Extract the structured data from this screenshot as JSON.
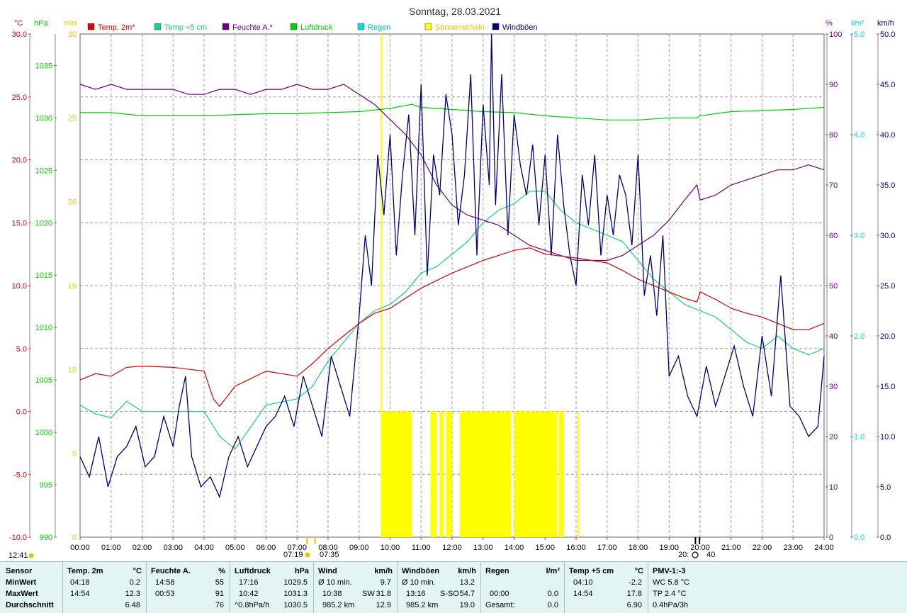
{
  "title": "Sonntag, 28.03.2021",
  "time_marker": "12:41",
  "sun_times": {
    "rise": "07:19",
    "rise_civil": "07:35",
    "set": "20:",
    "set2": "40"
  },
  "colors": {
    "temp": "#e00000",
    "temp5": "#19d27d",
    "humidity": "#6a0080",
    "pressure": "#00d000",
    "rain": "#00e0e0",
    "sunshine": "#ffff00",
    "gusts": "#00007a",
    "bg_footer": "#e2f4f4"
  },
  "axes": {
    "left": [
      {
        "unit": "°C",
        "ticks": [
          "30.0",
          "25.0",
          "20.0",
          "15.0",
          "10.0",
          "5.0",
          "0.0",
          "-5.0",
          "-10.0"
        ],
        "min": -10,
        "max": 30
      },
      {
        "unit": "hPa",
        "ticks": [
          "1035",
          "1030",
          "1025",
          "1020",
          "1015",
          "1010",
          "1005",
          "1000",
          "995",
          "990"
        ],
        "min": 990,
        "max": 1038
      },
      {
        "unit": "min",
        "ticks": [
          "30",
          "25",
          "20",
          "15",
          "10",
          "5",
          "0"
        ],
        "min": 0,
        "max": 30
      }
    ],
    "right": [
      {
        "unit": "%",
        "ticks": [
          "100",
          "90",
          "80",
          "70",
          "60",
          "50",
          "40",
          "30",
          "20",
          "10",
          "0"
        ],
        "min": 0,
        "max": 100
      },
      {
        "unit": "l/m²",
        "ticks": [
          "5.0",
          "4.0",
          "3.0",
          "2.0",
          "1.0",
          "0.0"
        ],
        "min": 0,
        "max": 5
      },
      {
        "unit": "km/h",
        "ticks": [
          "50.0",
          "45.0",
          "40.0",
          "35.0",
          "30.0",
          "25.0",
          "20.0",
          "15.0",
          "10.0",
          "5.0",
          "0.0"
        ],
        "min": 0,
        "max": 50
      }
    ],
    "x_ticks": [
      "00:00",
      "01:00",
      "02:00",
      "03:00",
      "04:00",
      "05:00",
      "06:00",
      "07:00",
      "08:00",
      "09:00",
      "10:00",
      "11:00",
      "12:00",
      "13:00",
      "14:00",
      "15:00",
      "16:00",
      "17:00",
      "18:00",
      "19:00",
      "20:00",
      "21:00",
      "22:00",
      "23:00",
      "24:00"
    ]
  },
  "legend": [
    {
      "label": "Temp. 2m*",
      "color": "#e00000"
    },
    {
      "label": "Temp +5 cm",
      "color": "#19d27d"
    },
    {
      "label": "Feuchte A.*",
      "color": "#6a0080"
    },
    {
      "label": "Luftdruck",
      "color": "#00d000"
    },
    {
      "label": "Regen",
      "color": "#00e0e0"
    },
    {
      "label": "Sonnenschein",
      "color": "#ffff00"
    },
    {
      "label": "Windböen",
      "color": "#00007a"
    }
  ],
  "chart_data": {
    "type": "line",
    "title": "Sonntag, 28.03.2021",
    "x_unit": "hours",
    "xlim": [
      0,
      24
    ],
    "grid": true,
    "legend_placement": "top",
    "series": [
      {
        "name": "Temp. 2m*",
        "axis": "°C",
        "x": [
          0,
          0.5,
          1,
          1.5,
          2,
          3,
          4,
          4.3,
          4.5,
          5,
          6,
          7,
          7.5,
          8,
          8.5,
          9,
          9.5,
          10,
          10.5,
          11,
          11.5,
          12,
          12.5,
          13,
          13.5,
          14,
          14.5,
          15,
          16,
          17,
          17.5,
          18,
          18.5,
          19,
          19.5,
          19.9,
          20,
          20.5,
          21,
          21.5,
          22,
          22.5,
          23,
          23.5,
          24
        ],
        "values": [
          2.5,
          3.0,
          2.8,
          3.5,
          3.6,
          3.5,
          3.2,
          1.0,
          0.4,
          2.0,
          3.2,
          2.8,
          3.8,
          5.0,
          6.0,
          7.0,
          7.8,
          8.2,
          9.0,
          9.8,
          10.4,
          11.0,
          11.5,
          12.0,
          12.4,
          12.8,
          13.0,
          12.5,
          12.2,
          11.8,
          11.2,
          10.5,
          10.0,
          9.5,
          9.0,
          8.7,
          9.5,
          8.9,
          8.2,
          7.8,
          7.5,
          7.0,
          6.5,
          6.5,
          7.0
        ]
      },
      {
        "name": "Temp +5 cm",
        "axis": "°C",
        "x": [
          0,
          0.5,
          1,
          1.5,
          2,
          3,
          4,
          4.5,
          5,
          6,
          7,
          7.5,
          8,
          8.5,
          9,
          9.5,
          10,
          10.5,
          11,
          11.5,
          12,
          12.5,
          13,
          13.5,
          14,
          14.5,
          15,
          15.5,
          16,
          16.5,
          17,
          17.5,
          18,
          18.5,
          19,
          19.5,
          20,
          20.5,
          21,
          21.5,
          22,
          22.5,
          23,
          23.5,
          24
        ],
        "values": [
          0.5,
          -0.2,
          -0.5,
          0.8,
          0.0,
          0.0,
          0.0,
          -2.0,
          -3.0,
          0.5,
          1.0,
          2.0,
          4.0,
          5.5,
          7.0,
          8.0,
          8.5,
          9.5,
          11.0,
          11.5,
          12.5,
          13.5,
          15.0,
          16.0,
          16.5,
          17.5,
          17.5,
          16.0,
          15.0,
          14.5,
          14.0,
          13.5,
          12.0,
          10.5,
          9.5,
          8.5,
          8.0,
          7.5,
          6.5,
          5.5,
          5.0,
          6.0,
          5.0,
          4.5,
          5.0
        ]
      },
      {
        "name": "Feuchte A.*",
        "axis": "%",
        "x": [
          0,
          0.5,
          1,
          1.5,
          2,
          2.5,
          3,
          3.5,
          4,
          4.5,
          5,
          5.5,
          6,
          6.5,
          7,
          7.5,
          8,
          8.5,
          9,
          9.5,
          10,
          10.5,
          11,
          11.5,
          12,
          12.5,
          13,
          13.5,
          14,
          14.5,
          15,
          15.5,
          16,
          16.5,
          17,
          17.5,
          18,
          18.5,
          19,
          19.5,
          19.9,
          20,
          20.5,
          21,
          21.5,
          22,
          22.5,
          23,
          23.5,
          24
        ],
        "values": [
          90,
          89,
          90,
          89,
          89,
          89,
          89,
          88,
          88,
          89,
          89,
          88,
          89,
          89,
          90,
          89,
          89,
          90,
          88,
          86,
          83,
          80,
          76,
          70,
          66,
          64,
          63,
          62,
          60,
          58,
          57,
          56,
          55,
          55,
          55,
          56,
          58,
          60,
          63,
          67,
          70,
          67,
          68,
          70,
          71,
          72,
          73,
          73,
          74,
          73
        ]
      },
      {
        "name": "Luftdruck",
        "axis": "hPa",
        "x": [
          0,
          1,
          2,
          3,
          4,
          5,
          6,
          7,
          8,
          9,
          10,
          10.7,
          11,
          12,
          13,
          14,
          15,
          16,
          17,
          18,
          19,
          19.9,
          20,
          21,
          22,
          23,
          24
        ],
        "values": [
          1030.5,
          1030.5,
          1030.2,
          1030.2,
          1030.2,
          1030.3,
          1030.4,
          1030.4,
          1030.5,
          1030.6,
          1030.9,
          1031.3,
          1031.0,
          1030.8,
          1030.6,
          1030.5,
          1030.2,
          1030.0,
          1029.8,
          1029.8,
          1030.0,
          1030.0,
          1030.2,
          1030.6,
          1030.7,
          1030.8,
          1031.0
        ]
      },
      {
        "name": "Windböen",
        "axis": "km/h",
        "x": [
          0,
          0.3,
          0.6,
          0.9,
          1.2,
          1.5,
          1.8,
          2.1,
          2.4,
          2.7,
          3.0,
          3.2,
          3.4,
          3.6,
          3.9,
          4.2,
          4.5,
          4.8,
          5.1,
          5.4,
          5.7,
          6.0,
          6.3,
          6.6,
          6.9,
          7.2,
          7.5,
          7.8,
          8.1,
          8.4,
          8.7,
          9.0,
          9.2,
          9.4,
          9.6,
          9.8,
          10.0,
          10.2,
          10.4,
          10.6,
          10.8,
          11.0,
          11.2,
          11.4,
          11.6,
          11.8,
          12.0,
          12.2,
          12.4,
          12.6,
          12.8,
          13.0,
          13.2,
          13.27,
          13.4,
          13.6,
          13.8,
          14.0,
          14.2,
          14.4,
          14.6,
          14.8,
          15.0,
          15.2,
          15.4,
          15.6,
          15.8,
          16.0,
          16.2,
          16.4,
          16.6,
          16.8,
          17.0,
          17.2,
          17.4,
          17.6,
          17.8,
          18.0,
          18.2,
          18.4,
          18.6,
          18.8,
          19.0,
          19.3,
          19.6,
          19.9,
          20.2,
          20.5,
          20.8,
          21.1,
          21.4,
          21.7,
          22.0,
          22.3,
          22.6,
          22.9,
          23.2,
          23.5,
          23.8,
          24
        ],
        "values": [
          8,
          6,
          10,
          5,
          8,
          9,
          11,
          7,
          8,
          12,
          9,
          13,
          16,
          8,
          5,
          6,
          4,
          8,
          10,
          7,
          9,
          11,
          12,
          14,
          11,
          16,
          13,
          10,
          18,
          15,
          12,
          22,
          30,
          25,
          38,
          32,
          40,
          28,
          36,
          42,
          30,
          45,
          26,
          38,
          34,
          44,
          40,
          31,
          36,
          46,
          28,
          43,
          35,
          50,
          33,
          46,
          30,
          42,
          37,
          34,
          39,
          31,
          38,
          28,
          40,
          33,
          28,
          25,
          36,
          31,
          38,
          28,
          34,
          30,
          36,
          34,
          29,
          38,
          24,
          28,
          22,
          30,
          16,
          18,
          14,
          12,
          17,
          13,
          16,
          19,
          15,
          12,
          20,
          14,
          26,
          13,
          12,
          10,
          11,
          18
        ]
      }
    ],
    "sunshine": {
      "name": "Sonnenschein",
      "axis": "min",
      "intervals": [
        [
          9.72,
          10.7
        ],
        [
          11.3,
          11.5
        ],
        [
          11.6,
          11.72
        ],
        [
          11.8,
          12.0
        ],
        [
          12.25,
          13.9
        ],
        [
          14.0,
          15.4
        ],
        [
          15.45,
          15.6
        ],
        [
          16.05,
          16.1
        ]
      ],
      "level": 7.5
    }
  },
  "stats": {
    "labels": {
      "sensor": "Sensor",
      "min": "MinWert",
      "max": "MaxWert",
      "avg": "Durchschnitt"
    },
    "temp": {
      "title": "Temp. 2m",
      "unit": "°C",
      "min_time": "04:18",
      "min_val": "0.2",
      "max_time": "14:54",
      "max_val": "12.3",
      "avg_val": "6.48"
    },
    "humidity": {
      "title": "Feuchte A.",
      "unit": "%",
      "min_time": "14:58",
      "min_val": "55",
      "max_time": "00:53",
      "max_val": "91",
      "avg_val": "76"
    },
    "pressure": {
      "title": "Luftdruck",
      "unit": "hPa",
      "min_time": "17:16",
      "min_val": "1029.5",
      "max_time": "10:42",
      "max_val": "1031.3",
      "avg_label": "^0.8hPa/h",
      "avg_val": "1030.5"
    },
    "wind": {
      "title": "Wind",
      "unit": "km/h",
      "r1_label": "Ø 10 min.",
      "r1_val": "9.7",
      "r2_time": "10:38",
      "r2_dir": "SW",
      "r2_val": "31.8",
      "r3_label": "985.2 km",
      "r3_val": "12.9"
    },
    "gusts": {
      "title": "Windböen",
      "unit": "km/h",
      "r1_label": "Ø 10 min.",
      "r1_val": "13.2",
      "r2_time": "13:16",
      "r2_dir": "S-SO",
      "r2_val": "54.7",
      "r3_label": "985.2 km",
      "r3_val": "19.0"
    },
    "rain": {
      "title": "Regen",
      "unit": "l/m²",
      "r2_time": "00:00",
      "r2_val": "0.0",
      "r3_label": "Gesamt:",
      "r3_val": "0.0"
    },
    "temp5": {
      "title": "Temp +5 cm",
      "unit": "°C",
      "min_time": "04:10",
      "min_val": "-2.2",
      "max_time": "14:54",
      "max_val": "17.8",
      "avg_val": "6.90"
    },
    "pmv": {
      "title": "PMV-1:-3",
      "r1": "WC 5.8 °C",
      "r2": "TP 2.4 °C",
      "r3": "0.4hPa/3h"
    }
  }
}
